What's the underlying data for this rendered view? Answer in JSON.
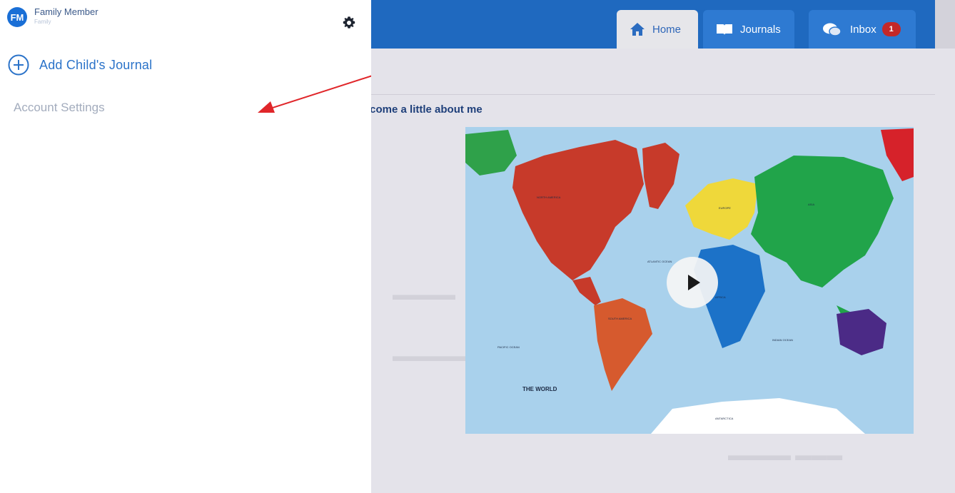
{
  "sidebar": {
    "user": {
      "initials": "FM",
      "name": "Family Member",
      "role": "Family"
    },
    "add_journal_label": "Add Child's Journal",
    "account_settings_label": "Account Settings",
    "settings_icon": "gear-icon"
  },
  "app": {
    "tabs": [
      {
        "label": "Home",
        "icon": "home-icon"
      },
      {
        "label": "Journals",
        "icon": "book-icon"
      },
      {
        "label": "Inbox",
        "icon": "chat-icon",
        "badge": "1"
      }
    ],
    "intro_title": "lcome a little about me",
    "video": {
      "map_title": "THE WORLD",
      "labels": [
        "NORTH AMERICA",
        "SOUTH AMERICA",
        "EUROPE",
        "ASIA",
        "AFRICA",
        "ANTARCTICA",
        "ATLANTIC OCEAN",
        "PACIFIC OCEAN",
        "INDIAN OCEAN"
      ]
    }
  },
  "colors": {
    "nav_blue": "#1f69bf",
    "tab_blue": "#2e7ad2",
    "link_blue": "#2b73c9",
    "badge_red": "#c42828",
    "arrow_red": "#e0262a"
  }
}
